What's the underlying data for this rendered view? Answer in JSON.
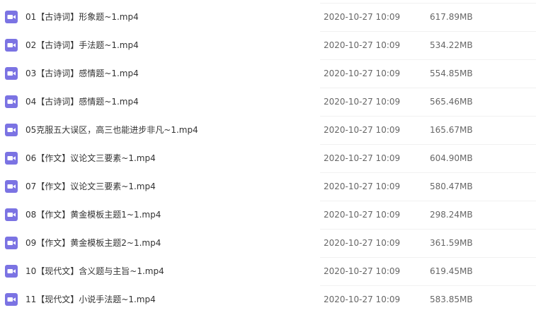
{
  "colors": {
    "icon_bg": "#7b73e3",
    "icon_fg": "#ffffff",
    "text": "#333333",
    "meta_text": "#666666"
  },
  "files": [
    {
      "name": "01【古诗词】形象题~1.mp4",
      "date": "2020-10-27 10:09",
      "size": "617.89MB",
      "icon": "video-file-icon"
    },
    {
      "name": "02【古诗词】手法题~1.mp4",
      "date": "2020-10-27 10:09",
      "size": "534.22MB",
      "icon": "video-file-icon"
    },
    {
      "name": "03【古诗词】感情题~1.mp4",
      "date": "2020-10-27 10:09",
      "size": "554.85MB",
      "icon": "video-file-icon"
    },
    {
      "name": "04【古诗词】感情题~1.mp4",
      "date": "2020-10-27 10:09",
      "size": "565.46MB",
      "icon": "video-file-icon"
    },
    {
      "name": "05克服五大误区，高三也能进步非凡~1.mp4",
      "date": "2020-10-27 10:09",
      "size": "165.67MB",
      "icon": "video-file-icon"
    },
    {
      "name": "06【作文】议论文三要素~1.mp4",
      "date": "2020-10-27 10:09",
      "size": "604.90MB",
      "icon": "video-file-icon"
    },
    {
      "name": "07【作文】议论文三要素~1.mp4",
      "date": "2020-10-27 10:09",
      "size": "580.47MB",
      "icon": "video-file-icon"
    },
    {
      "name": "08【作文】黄金模板主题1~1.mp4",
      "date": "2020-10-27 10:09",
      "size": "298.24MB",
      "icon": "video-file-icon"
    },
    {
      "name": "09【作文】黄金模板主题2~1.mp4",
      "date": "2020-10-27 10:09",
      "size": "361.59MB",
      "icon": "video-file-icon"
    },
    {
      "name": "10【现代文】含义题与主旨~1.mp4",
      "date": "2020-10-27 10:09",
      "size": "619.45MB",
      "icon": "video-file-icon"
    },
    {
      "name": "11【现代文】小说手法题~1.mp4",
      "date": "2020-10-27 10:09",
      "size": "583.85MB",
      "icon": "video-file-icon"
    }
  ]
}
